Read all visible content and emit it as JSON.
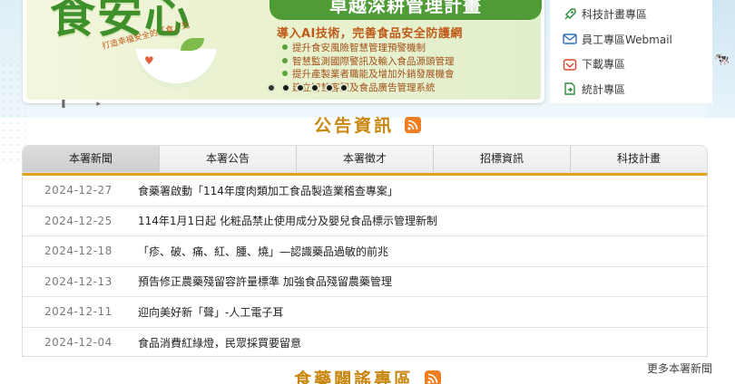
{
  "banner": {
    "title": "食安心",
    "pill": "卓越深耕管理計畫",
    "subtitle": "導入AI技術，完善食品安全防護網",
    "arc_text": "打造幸福安全的「食」光",
    "bullets": [
      "提升食安風險智慧管理預警機制",
      "智慧監測國際警訊及輸入食品源頭管理",
      "提升產製業者職能及增加外銷發展機會",
      "建立智慧客服及食品廣告管理系統"
    ],
    "dots_count": 6
  },
  "quicklinks": [
    {
      "label": "科技計畫專區",
      "icon": "rocket-icon"
    },
    {
      "label": "員工專區Webmail",
      "icon": "mail-icon"
    },
    {
      "label": "下載專區",
      "icon": "download-icon"
    },
    {
      "label": "統計專區",
      "icon": "chart-icon"
    }
  ],
  "sections": {
    "announcements": "公告資訊",
    "debunk": "食藥闢謠專區"
  },
  "tabs": [
    "本署新聞",
    "本署公告",
    "本署徵才",
    "招標資訊",
    "科技計畫"
  ],
  "news": [
    {
      "date": "2024-12-27",
      "title": "食藥署啟動「114年度肉類加工食品製造業稽查專案」"
    },
    {
      "date": "2024-12-25",
      "title": "114年1月1日起 化粧品禁止使用成分及嬰兒食品標示管理新制"
    },
    {
      "date": "2024-12-18",
      "title": "「疹、破、痛、紅、腫、燒」—認識藥品過敏的前兆"
    },
    {
      "date": "2024-12-13",
      "title": "預告修正農藥殘留容許量標準 加強食品殘留農藥管理"
    },
    {
      "date": "2024-12-11",
      "title": "迎向美好新「聲」-人工電子耳"
    },
    {
      "date": "2024-12-04",
      "title": "食品消費紅綠燈，民眾採買要留意"
    }
  ],
  "more_label": "更多本署新聞",
  "colors": {
    "accent": "#e3a11e",
    "section_title": "#c8860c",
    "rss": "#ef7e22",
    "banner_green": "#4f9c36"
  }
}
